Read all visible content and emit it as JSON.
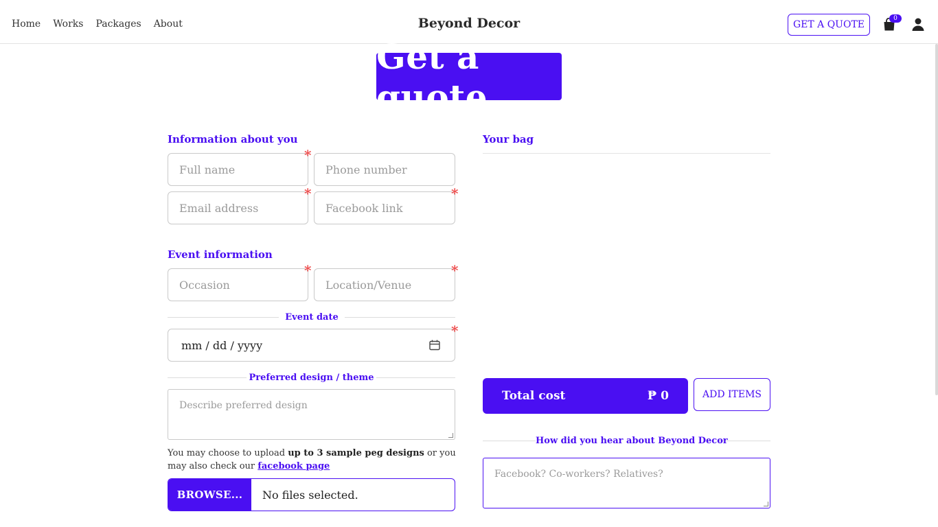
{
  "nav": {
    "links": [
      "Home",
      "Works",
      "Packages",
      "About"
    ],
    "brand": "Beyond Decor",
    "quote_button": "GET A QUOTE",
    "bag_count": "0",
    "icons": {
      "bag": "shopping-bag-icon",
      "user": "user-icon"
    }
  },
  "page_title": "Get a quote",
  "info": {
    "heading": "Information about you",
    "full_name": "Full name",
    "phone": "Phone number",
    "email": "Email address",
    "facebook": "Facebook link"
  },
  "event": {
    "heading": "Event information",
    "occasion": "Occasion",
    "venue": "Location/Venue",
    "date_label": "Event date",
    "date_placeholder": "mm / dd / yyyy"
  },
  "design": {
    "label": "Preferred design / theme",
    "placeholder": "Describe preferred design",
    "note_before": "You may choose to upload ",
    "note_bold": "up to 3 sample peg designs",
    "note_after": " or you may also check our ",
    "note_link": "facebook page",
    "browse": "BROWSE...",
    "file_status": "No files selected."
  },
  "bag": {
    "heading": "Your bag",
    "total_label": "Total cost",
    "total_amount": "₱ 0",
    "add_items": "ADD ITEMS"
  },
  "hear": {
    "label": "How did you hear about Beyond Decor",
    "placeholder": "Facebook? Co-workers? Relatives?"
  },
  "colors": {
    "accent": "#4a0ff2",
    "required": "#ee4b4b"
  }
}
